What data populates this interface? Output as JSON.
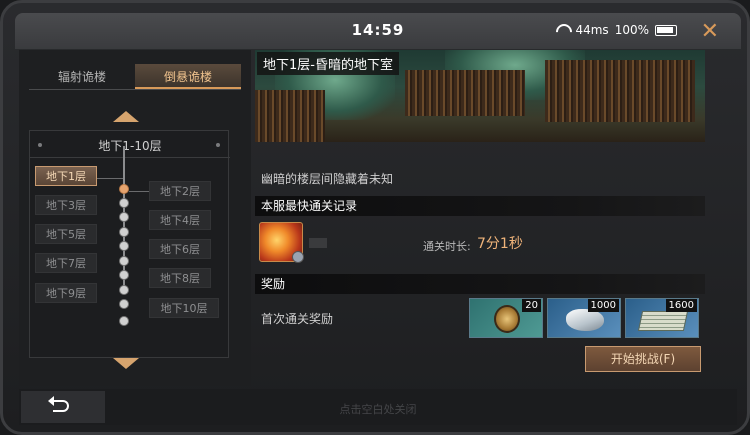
{
  "status": {
    "time": "14:59",
    "ping": "44ms",
    "battery": "100%"
  },
  "tabs": [
    {
      "label": "辐射诡楼",
      "active": false
    },
    {
      "label": "倒悬诡楼",
      "active": true
    }
  ],
  "floor_group": {
    "range_label": "地下1-10层"
  },
  "floors": {
    "f1": "地下1层",
    "f2": "地下2层",
    "f3": "地下3层",
    "f4": "地下4层",
    "f5": "地下5层",
    "f6": "地下6层",
    "f7": "地下7层",
    "f8": "地下8层",
    "f9": "地下9层",
    "f10": "地下10层",
    "selected": "地下1层"
  },
  "detail": {
    "banner_title": "地下1层-昏暗的地下室",
    "description": "幽暗的楼层间隐藏着未知",
    "record_header": "本服最快通关记录",
    "time_label": "通关时长:",
    "time_value": "7分1秒",
    "reward_header": "奖励",
    "first_clear_label": "首次通关奖励",
    "rewards": [
      {
        "icon": "medal-icon",
        "count": "20"
      },
      {
        "icon": "silver-ore-icon",
        "count": "1000"
      },
      {
        "icon": "cash-stack-icon",
        "count": "1600"
      }
    ],
    "start_button": "开始挑战(F)"
  },
  "footer": {
    "hint": "点击空白处关闭"
  },
  "colors": {
    "accent": "#d89a5a",
    "highlight": "#f0b47a"
  }
}
